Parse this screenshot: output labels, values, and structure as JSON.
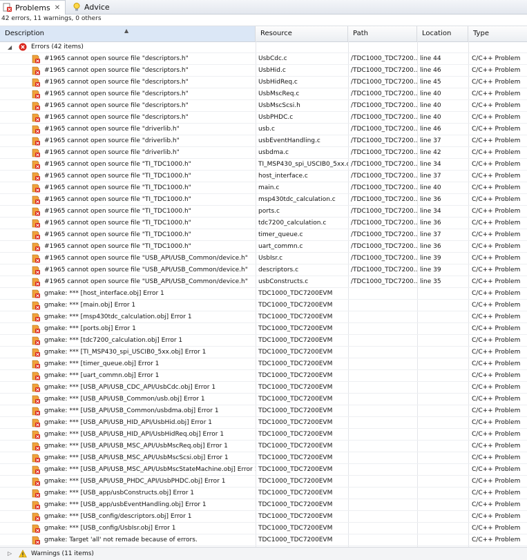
{
  "tabs": {
    "problems": "Problems",
    "advice": "Advice"
  },
  "summary": "42 errors, 11 warnings, 0 others",
  "columns": {
    "description": "Description",
    "resource": "Resource",
    "path": "Path",
    "location": "Location",
    "type": "Type"
  },
  "errors_group": "Errors (42 items)",
  "warnings_group": "Warnings (11 items)",
  "rows": [
    {
      "d": "#1965 cannot open source file \"descriptors.h\"",
      "r": "UsbCdc.c",
      "p": "/TDC1000_TDC7200...",
      "l": "line 44",
      "t": "C/C++ Problem"
    },
    {
      "d": "#1965 cannot open source file \"descriptors.h\"",
      "r": "UsbHid.c",
      "p": "/TDC1000_TDC7200...",
      "l": "line 46",
      "t": "C/C++ Problem"
    },
    {
      "d": "#1965 cannot open source file \"descriptors.h\"",
      "r": "UsbHidReq.c",
      "p": "/TDC1000_TDC7200...",
      "l": "line 45",
      "t": "C/C++ Problem"
    },
    {
      "d": "#1965 cannot open source file \"descriptors.h\"",
      "r": "UsbMscReq.c",
      "p": "/TDC1000_TDC7200...",
      "l": "line 40",
      "t": "C/C++ Problem"
    },
    {
      "d": "#1965 cannot open source file \"descriptors.h\"",
      "r": "UsbMscScsi.h",
      "p": "/TDC1000_TDC7200...",
      "l": "line 40",
      "t": "C/C++ Problem"
    },
    {
      "d": "#1965 cannot open source file \"descriptors.h\"",
      "r": "UsbPHDC.c",
      "p": "/TDC1000_TDC7200...",
      "l": "line 40",
      "t": "C/C++ Problem"
    },
    {
      "d": "#1965 cannot open source file \"driverlib.h\"",
      "r": "usb.c",
      "p": "/TDC1000_TDC7200...",
      "l": "line 46",
      "t": "C/C++ Problem"
    },
    {
      "d": "#1965 cannot open source file \"driverlib.h\"",
      "r": "usbEventHandling.c",
      "p": "/TDC1000_TDC7200...",
      "l": "line 37",
      "t": "C/C++ Problem"
    },
    {
      "d": "#1965 cannot open source file \"driverlib.h\"",
      "r": "usbdma.c",
      "p": "/TDC1000_TDC7200...",
      "l": "line 42",
      "t": "C/C++ Problem"
    },
    {
      "d": "#1965 cannot open source file \"TI_TDC1000.h\"",
      "r": "TI_MSP430_spi_USCIB0_5xx.c",
      "p": "/TDC1000_TDC7200...",
      "l": "line 34",
      "t": "C/C++ Problem"
    },
    {
      "d": "#1965 cannot open source file \"TI_TDC1000.h\"",
      "r": "host_interface.c",
      "p": "/TDC1000_TDC7200...",
      "l": "line 37",
      "t": "C/C++ Problem"
    },
    {
      "d": "#1965 cannot open source file \"TI_TDC1000.h\"",
      "r": "main.c",
      "p": "/TDC1000_TDC7200...",
      "l": "line 40",
      "t": "C/C++ Problem"
    },
    {
      "d": "#1965 cannot open source file \"TI_TDC1000.h\"",
      "r": "msp430tdc_calculation.c",
      "p": "/TDC1000_TDC7200...",
      "l": "line 36",
      "t": "C/C++ Problem"
    },
    {
      "d": "#1965 cannot open source file \"TI_TDC1000.h\"",
      "r": "ports.c",
      "p": "/TDC1000_TDC7200...",
      "l": "line 34",
      "t": "C/C++ Problem"
    },
    {
      "d": "#1965 cannot open source file \"TI_TDC1000.h\"",
      "r": "tdc7200_calculation.c",
      "p": "/TDC1000_TDC7200...",
      "l": "line 36",
      "t": "C/C++ Problem"
    },
    {
      "d": "#1965 cannot open source file \"TI_TDC1000.h\"",
      "r": "timer_queue.c",
      "p": "/TDC1000_TDC7200...",
      "l": "line 37",
      "t": "C/C++ Problem"
    },
    {
      "d": "#1965 cannot open source file \"TI_TDC1000.h\"",
      "r": "uart_commn.c",
      "p": "/TDC1000_TDC7200...",
      "l": "line 36",
      "t": "C/C++ Problem"
    },
    {
      "d": "#1965 cannot open source file \"USB_API/USB_Common/device.h\"",
      "r": "UsbIsr.c",
      "p": "/TDC1000_TDC7200...",
      "l": "line 39",
      "t": "C/C++ Problem"
    },
    {
      "d": "#1965 cannot open source file \"USB_API/USB_Common/device.h\"",
      "r": "descriptors.c",
      "p": "/TDC1000_TDC7200...",
      "l": "line 39",
      "t": "C/C++ Problem"
    },
    {
      "d": "#1965 cannot open source file \"USB_API/USB_Common/device.h\"",
      "r": "usbConstructs.c",
      "p": "/TDC1000_TDC7200...",
      "l": "line 35",
      "t": "C/C++ Problem"
    },
    {
      "d": "gmake: *** [host_interface.obj] Error 1",
      "r": "TDC1000_TDC7200EVM",
      "p": "",
      "l": "",
      "t": "C/C++ Problem"
    },
    {
      "d": "gmake: *** [main.obj] Error 1",
      "r": "TDC1000_TDC7200EVM",
      "p": "",
      "l": "",
      "t": "C/C++ Problem"
    },
    {
      "d": "gmake: *** [msp430tdc_calculation.obj] Error 1",
      "r": "TDC1000_TDC7200EVM",
      "p": "",
      "l": "",
      "t": "C/C++ Problem"
    },
    {
      "d": "gmake: *** [ports.obj] Error 1",
      "r": "TDC1000_TDC7200EVM",
      "p": "",
      "l": "",
      "t": "C/C++ Problem"
    },
    {
      "d": "gmake: *** [tdc7200_calculation.obj] Error 1",
      "r": "TDC1000_TDC7200EVM",
      "p": "",
      "l": "",
      "t": "C/C++ Problem"
    },
    {
      "d": "gmake: *** [TI_MSP430_spi_USCIB0_5xx.obj] Error 1",
      "r": "TDC1000_TDC7200EVM",
      "p": "",
      "l": "",
      "t": "C/C++ Problem"
    },
    {
      "d": "gmake: *** [timer_queue.obj] Error 1",
      "r": "TDC1000_TDC7200EVM",
      "p": "",
      "l": "",
      "t": "C/C++ Problem"
    },
    {
      "d": "gmake: *** [uart_commn.obj] Error 1",
      "r": "TDC1000_TDC7200EVM",
      "p": "",
      "l": "",
      "t": "C/C++ Problem"
    },
    {
      "d": "gmake: *** [USB_API/USB_CDC_API/UsbCdc.obj] Error 1",
      "r": "TDC1000_TDC7200EVM",
      "p": "",
      "l": "",
      "t": "C/C++ Problem"
    },
    {
      "d": "gmake: *** [USB_API/USB_Common/usb.obj] Error 1",
      "r": "TDC1000_TDC7200EVM",
      "p": "",
      "l": "",
      "t": "C/C++ Problem"
    },
    {
      "d": "gmake: *** [USB_API/USB_Common/usbdma.obj] Error 1",
      "r": "TDC1000_TDC7200EVM",
      "p": "",
      "l": "",
      "t": "C/C++ Problem"
    },
    {
      "d": "gmake: *** [USB_API/USB_HID_API/UsbHid.obj] Error 1",
      "r": "TDC1000_TDC7200EVM",
      "p": "",
      "l": "",
      "t": "C/C++ Problem"
    },
    {
      "d": "gmake: *** [USB_API/USB_HID_API/UsbHidReq.obj] Error 1",
      "r": "TDC1000_TDC7200EVM",
      "p": "",
      "l": "",
      "t": "C/C++ Problem"
    },
    {
      "d": "gmake: *** [USB_API/USB_MSC_API/UsbMscReq.obj] Error 1",
      "r": "TDC1000_TDC7200EVM",
      "p": "",
      "l": "",
      "t": "C/C++ Problem"
    },
    {
      "d": "gmake: *** [USB_API/USB_MSC_API/UsbMscScsi.obj] Error 1",
      "r": "TDC1000_TDC7200EVM",
      "p": "",
      "l": "",
      "t": "C/C++ Problem"
    },
    {
      "d": "gmake: *** [USB_API/USB_MSC_API/UsbMscStateMachine.obj] Error 1",
      "r": "TDC1000_TDC7200EVM",
      "p": "",
      "l": "",
      "t": "C/C++ Problem"
    },
    {
      "d": "gmake: *** [USB_API/USB_PHDC_API/UsbPHDC.obj] Error 1",
      "r": "TDC1000_TDC7200EVM",
      "p": "",
      "l": "",
      "t": "C/C++ Problem"
    },
    {
      "d": "gmake: *** [USB_app/usbConstructs.obj] Error 1",
      "r": "TDC1000_TDC7200EVM",
      "p": "",
      "l": "",
      "t": "C/C++ Problem"
    },
    {
      "d": "gmake: *** [USB_app/usbEventHandling.obj] Error 1",
      "r": "TDC1000_TDC7200EVM",
      "p": "",
      "l": "",
      "t": "C/C++ Problem"
    },
    {
      "d": "gmake: *** [USB_config/descriptors.obj] Error 1",
      "r": "TDC1000_TDC7200EVM",
      "p": "",
      "l": "",
      "t": "C/C++ Problem"
    },
    {
      "d": "gmake: *** [USB_config/UsbIsr.obj] Error 1",
      "r": "TDC1000_TDC7200EVM",
      "p": "",
      "l": "",
      "t": "C/C++ Problem"
    },
    {
      "d": "gmake: Target 'all' not remade because of errors.",
      "r": "TDC1000_TDC7200EVM",
      "p": "",
      "l": "",
      "t": "C/C++ Problem"
    }
  ],
  "colors": {
    "error_red": "#d9251c",
    "warning_yellow": "#f4c21b",
    "header_sorted": "#dbe7f6"
  }
}
